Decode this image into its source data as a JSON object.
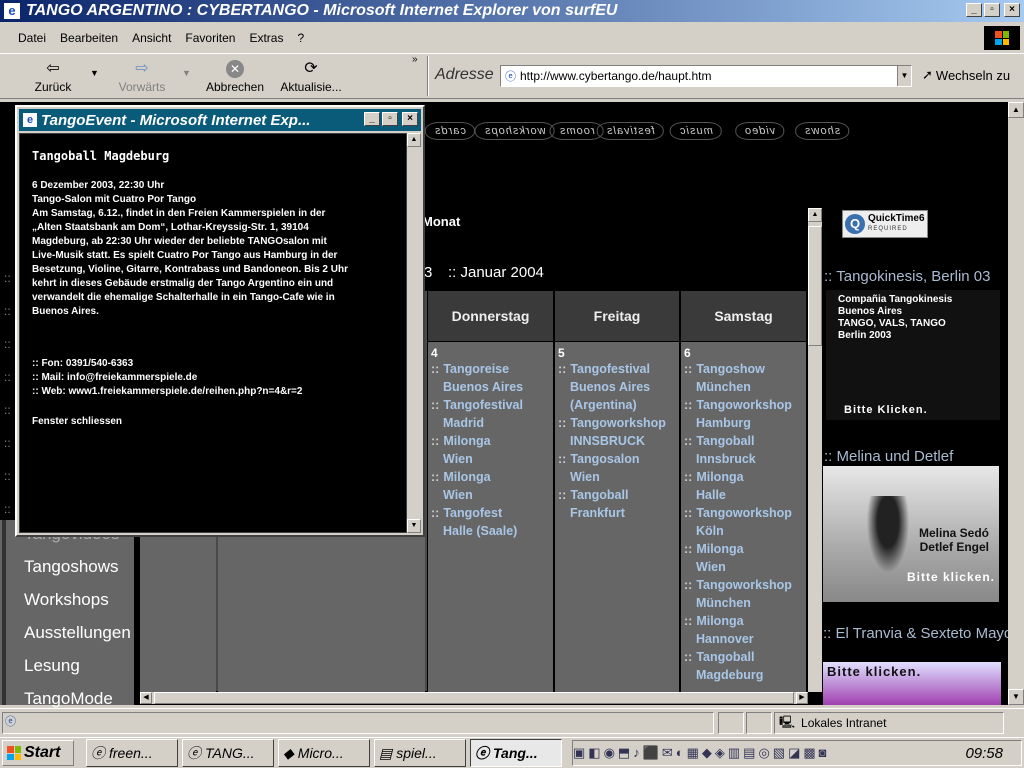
{
  "window": {
    "title": "TANGO ARGENTINO : CYBERTANGO - Microsoft Internet Explorer von surfEU"
  },
  "menu": [
    "Datei",
    "Bearbeiten",
    "Ansicht",
    "Favoriten",
    "Extras",
    "?"
  ],
  "toolbar": {
    "back": "Zurück",
    "forward": "Vorwärts",
    "stop": "Abbrechen",
    "refresh": "Aktualisie..."
  },
  "address": {
    "label": "Adresse",
    "url": "http://www.cybertango.de/haupt.htm",
    "go": "Wechseln zu"
  },
  "site_nav": [
    "shows",
    "video",
    "music",
    "festivals",
    "rooms",
    "workshops",
    "cards"
  ],
  "calendar": {
    "month_label": "Monat",
    "prev_frag": "3",
    "title": ":: Januar 2004",
    "days": [
      {
        "name": "Donnerstag",
        "date": "4",
        "events": [
          [
            "Tangoreise",
            "Buenos Aires"
          ],
          [
            "Tangofestival",
            "Madrid"
          ],
          [
            "Milonga",
            "Wien"
          ],
          [
            "Milonga",
            "Wien"
          ],
          [
            "Tangofest",
            "Halle (Saale)"
          ]
        ]
      },
      {
        "name": "Freitag",
        "date": "5",
        "events": [
          [
            "Tangofestival",
            "Buenos Aires (Argentina)"
          ],
          [
            "Tangoworkshop",
            "INNSBRUCK"
          ],
          [
            "Tangosalon",
            "Wien"
          ],
          [
            "Tangoball",
            "Frankfurt"
          ]
        ]
      },
      {
        "name": "Samstag",
        "date": "6",
        "events": [
          [
            "Tangoshow",
            "München"
          ],
          [
            "Tangoworkshop",
            "Hamburg"
          ],
          [
            "Tangoball",
            "Innsbruck"
          ],
          [
            "Milonga",
            "Halle"
          ],
          [
            "Tangoworkshop",
            "Köln"
          ],
          [
            "Milonga",
            "Wien"
          ],
          [
            "Tangoworkshop",
            "München"
          ],
          [
            "Milonga",
            "Hannover"
          ],
          [
            "Tangoball",
            "Magdeburg"
          ]
        ]
      }
    ]
  },
  "left_menu": [
    "Tangovideos",
    "Tangoshows",
    "Workshops",
    "Ausstellungen",
    "Lesung",
    "TangoMode"
  ],
  "right_panel": {
    "quicktime": {
      "name": "QuickTime6",
      "sub": "REQUIRED"
    },
    "ads": [
      {
        "title": ":: Tangokinesis, Berlin 03",
        "lines": [
          "Compañia Tangokinesis",
          "Buenos Aires",
          "TANGO, VALS, TANGO",
          "Berlin 2003"
        ],
        "cta": "Bitte Klicken."
      },
      {
        "title": ":: Melina und Detlef",
        "lines": [
          "Melina Sedó",
          "Detlef Engel"
        ],
        "cta": "Bitte klicken."
      },
      {
        "title": ":: El Tranvia & Sexteto Mayor",
        "lines": [],
        "cta": "Bitte klicken."
      }
    ]
  },
  "popup": {
    "title": "TangoEvent - Microsoft Internet Exp...",
    "heading": "Tangoball  Magdeburg",
    "lines": [
      "6 Dezember 2003, 22:30 Uhr",
      "Tango-Salon mit Cuatro Por Tango",
      "Am Samstag, 6.12., findet in den Freien Kammerspielen in der",
      "„Alten Staatsbank am Dom“, Lothar-Kreyssig-Str. 1, 39104",
      "Magdeburg, ab 22:30 Uhr wieder der beliebte TANGOsalon mit",
      "Live-Musik statt. Es spielt Cuatro Por Tango aus Hamburg in der",
      "Besetzung, Violine, Gitarre, Kontrabass und Bandoneon. Bis 2 Uhr",
      "kehrt in dieses Gebäude erstmalig der Tango Argentino ein und",
      "verwandelt die ehemalige Schalterhalle in ein Tango-Cafe wie in",
      "Buenos Aires."
    ],
    "contacts": [
      ":: Fon: 0391/540-6363",
      ":: Mail: info@freiekammerspiele.de",
      ":: Web: www1.freiekammerspiele.de/reihen.php?n=4&r=2"
    ],
    "close": "Fenster schliessen"
  },
  "status": {
    "zone": "Lokales Intranet"
  },
  "taskbar": {
    "start": "Start",
    "tasks": [
      "freen...",
      "TANG...",
      "Micro...",
      "spiel...",
      "Tang..."
    ],
    "clock": "09:58"
  }
}
